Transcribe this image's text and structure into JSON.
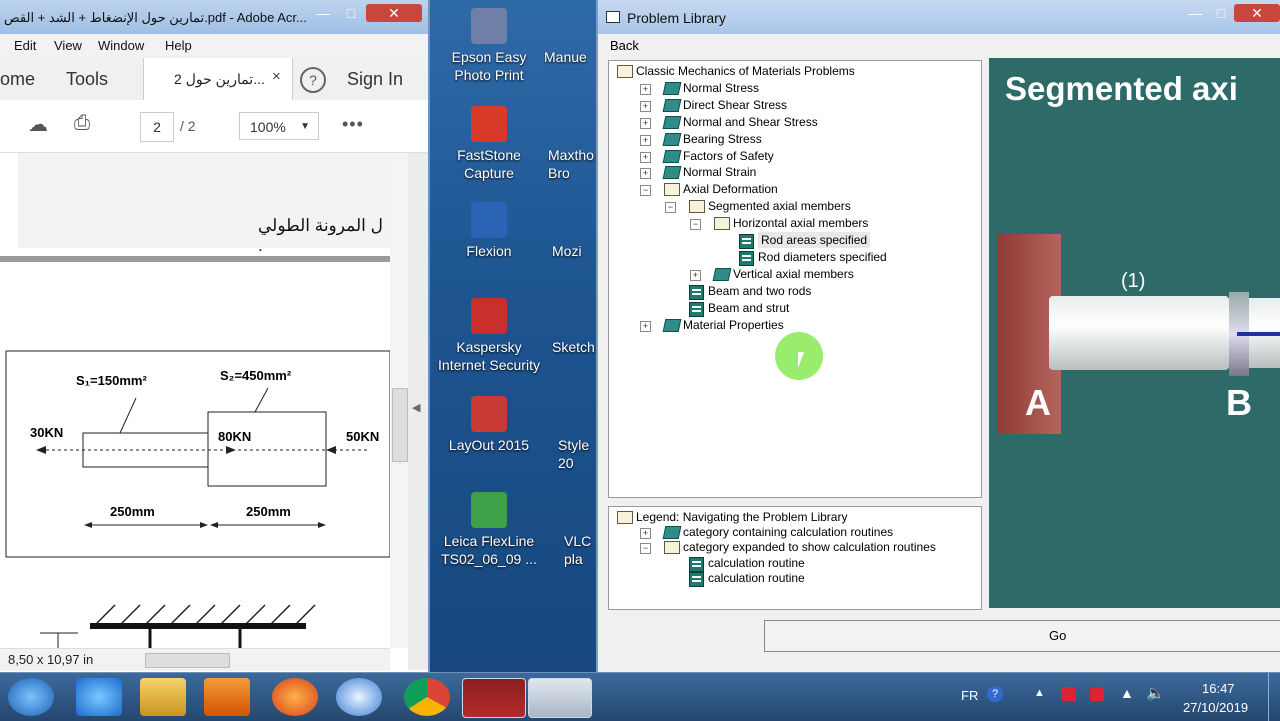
{
  "acrobat": {
    "title": "تمارين حول الإنضغاط + الشد + القص.pdf - Adobe Acr...",
    "menu": [
      "Edit",
      "View",
      "Window",
      "Help"
    ],
    "tab_home": "ome",
    "tab_tools": "Tools",
    "doc_tab_label": "2 تمارين حول...",
    "sign_in": "Sign In",
    "page_current": "2",
    "page_total": "/ 2",
    "zoom": "100%",
    "arabic_line": "ل المرونة الطولي .",
    "page_size": "8,50 x 10,97 in",
    "figure": {
      "s1": "S₁=150mm²",
      "s2": "S₂=450mm²",
      "f_left": "30KN",
      "f_mid": "80KN",
      "f_right": "50KN",
      "len1": "250mm",
      "len2": "250mm"
    }
  },
  "desktop_icons": [
    {
      "label": "Epson Easy Photo Print",
      "color": "#6f7fa8"
    },
    {
      "label": "FastStone Capture",
      "color": "#d83a2a"
    },
    {
      "label": "Flexion",
      "color": "#2b63b5"
    },
    {
      "label": "Kaspersky Internet Security",
      "color": "#c9302c"
    },
    {
      "label": "LayOut 2015",
      "color": "#c73a35"
    },
    {
      "label": "Leica FlexLine TS02_06_09 ...",
      "color": "#3fa04a"
    }
  ],
  "desktop_partial": [
    "Manue",
    "Maxtho Bro",
    "Mozi",
    "Sketch",
    "Style 20",
    "VLC pla"
  ],
  "problem_library": {
    "title": "Problem Library",
    "back": "Back",
    "tree": [
      {
        "label": "Classic Mechanics of Materials Problems",
        "kind": "open-book",
        "level": 0,
        "expander": ""
      },
      {
        "label": "Normal Stress",
        "kind": "book",
        "level": 1,
        "expander": "+"
      },
      {
        "label": "Direct Shear Stress",
        "kind": "book",
        "level": 1,
        "expander": "+"
      },
      {
        "label": "Normal and Shear Stress",
        "kind": "book",
        "level": 1,
        "expander": "+"
      },
      {
        "label": "Bearing Stress",
        "kind": "book",
        "level": 1,
        "expander": "+"
      },
      {
        "label": "Factors of Safety",
        "kind": "book",
        "level": 1,
        "expander": "+"
      },
      {
        "label": "Normal Strain",
        "kind": "book",
        "level": 1,
        "expander": "+"
      },
      {
        "label": "Axial Deformation",
        "kind": "open-book",
        "level": 1,
        "expander": "−"
      },
      {
        "label": "Segmented axial members",
        "kind": "open-book",
        "level": 2,
        "expander": "−"
      },
      {
        "label": "Horizontal axial members",
        "kind": "open-book",
        "level": 3,
        "expander": "−"
      },
      {
        "label": "Rod areas specified",
        "kind": "routine",
        "level": 4,
        "expander": "",
        "selected": true
      },
      {
        "label": "Rod diameters specified",
        "kind": "routine",
        "level": 4,
        "expander": ""
      },
      {
        "label": "Vertical axial members",
        "kind": "book",
        "level": 3,
        "expander": "+"
      },
      {
        "label": "Beam and two rods",
        "kind": "routine",
        "level": 2,
        "expander": ""
      },
      {
        "label": "Beam and strut",
        "kind": "routine",
        "level": 2,
        "expander": ""
      },
      {
        "label": "Material Properties",
        "kind": "book",
        "level": 1,
        "expander": "+"
      }
    ],
    "legend": [
      {
        "label": "Legend:  Navigating the Problem Library",
        "kind": "open-book",
        "level": 0,
        "expander": ""
      },
      {
        "label": "category containing calculation routines",
        "kind": "book",
        "level": 1,
        "expander": "+"
      },
      {
        "label": "category expanded to show calculation routines",
        "kind": "open-book",
        "level": 1,
        "expander": "−"
      },
      {
        "label": "calculation routine",
        "kind": "routine",
        "level": 2,
        "expander": ""
      },
      {
        "label": "calculation routine",
        "kind": "routine",
        "level": 2,
        "expander": ""
      }
    ],
    "preview": {
      "heading": "Segmented axi",
      "label_a": "A",
      "label_b": "B",
      "segment": "(1)"
    },
    "go": "Go"
  },
  "taskbar": {
    "lang": "FR",
    "time": "16:47",
    "date": "27/10/2019"
  }
}
